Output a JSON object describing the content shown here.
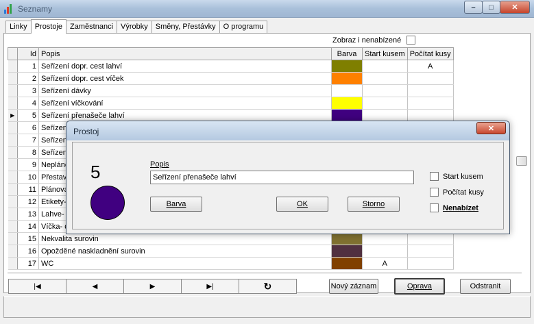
{
  "window": {
    "title": "Seznamy",
    "min": "–",
    "max": "□",
    "close": "✕"
  },
  "tabs": [
    "Linky",
    "Prostoje",
    "Zaměstnanci",
    "Výrobky",
    "Směny, Přestávky",
    "O programu"
  ],
  "filter": {
    "label": "Zobraz i nenabízené"
  },
  "grid": {
    "headers": {
      "id": "Id",
      "popis": "Popis",
      "barva": "Barva",
      "start": "Start kusem",
      "pocitat": "Počítat kusy"
    },
    "current_marker": "▶",
    "rows": [
      {
        "id": "1",
        "popis": "Seřízení dopr. cest lahví",
        "color": "#7f7f00",
        "start": "",
        "pocitat": "A"
      },
      {
        "id": "2",
        "popis": "Seřízení dopr. cest víček",
        "color": "#ff8000",
        "start": "",
        "pocitat": ""
      },
      {
        "id": "3",
        "popis": "Seřízení dávky",
        "color": "#ffffff",
        "start": "",
        "pocitat": ""
      },
      {
        "id": "4",
        "popis": "Seřízení víčkování",
        "color": "#ffff00",
        "start": "",
        "pocitat": ""
      },
      {
        "id": "5",
        "popis": "Seřízení přenašeče lahví",
        "color": "#400080",
        "start": "",
        "pocitat": ""
      },
      {
        "id": "6",
        "popis": "Seřízení",
        "color": "#c080ff",
        "start": "",
        "pocitat": ""
      },
      {
        "id": "7",
        "popis": "Seřízení",
        "color": "#20a0a0",
        "start": "",
        "pocitat": ""
      },
      {
        "id": "8",
        "popis": "Seřízení",
        "color": "#ffffff",
        "start": "",
        "pocitat": ""
      },
      {
        "id": "9",
        "popis": "Neplánov",
        "color": "#ffffff",
        "start": "",
        "pocitat": ""
      },
      {
        "id": "10",
        "popis": "Přestavb",
        "color": "#ffffff",
        "start": "",
        "pocitat": ""
      },
      {
        "id": "11",
        "popis": "Plánovan",
        "color": "#ffffff",
        "start": "",
        "pocitat": ""
      },
      {
        "id": "12",
        "popis": "Etikety- c",
        "color": "#ffffff",
        "start": "",
        "pocitat": ""
      },
      {
        "id": "13",
        "popis": "Lahve- c",
        "color": "#ffffff",
        "start": "",
        "pocitat": ""
      },
      {
        "id": "14",
        "popis": "Víčka- d",
        "color": "#ffffff",
        "start": "",
        "pocitat": ""
      },
      {
        "id": "15",
        "popis": "Nekvalita surovin",
        "color": "#7f7030",
        "start": "",
        "pocitat": ""
      },
      {
        "id": "16",
        "popis": "Opožděné naskladnění surovin",
        "color": "#503040",
        "start": "",
        "pocitat": ""
      },
      {
        "id": "17",
        "popis": "WC",
        "color": "#804000",
        "start": "A",
        "pocitat": ""
      }
    ]
  },
  "navigator": {
    "first": "|◀",
    "prev": "◀",
    "next": "▶",
    "last": "▶|",
    "refresh": "↻"
  },
  "buttons": {
    "new": "Nový záznam",
    "edit": "Oprava",
    "delete": "Odstranit"
  },
  "dialog": {
    "title": "Prostoj",
    "close": "✕",
    "id_value": "5",
    "color": "#400080",
    "popis_label": "Popis",
    "popis_value": "Seřízení přenašeče lahví",
    "barva_button": "Barva",
    "ok_button": "OK",
    "storno_button": "Storno",
    "start_kusem": "Start kusem",
    "pocitat_kusy": "Počítat kusy",
    "nenabizet": "Nenabízet"
  }
}
